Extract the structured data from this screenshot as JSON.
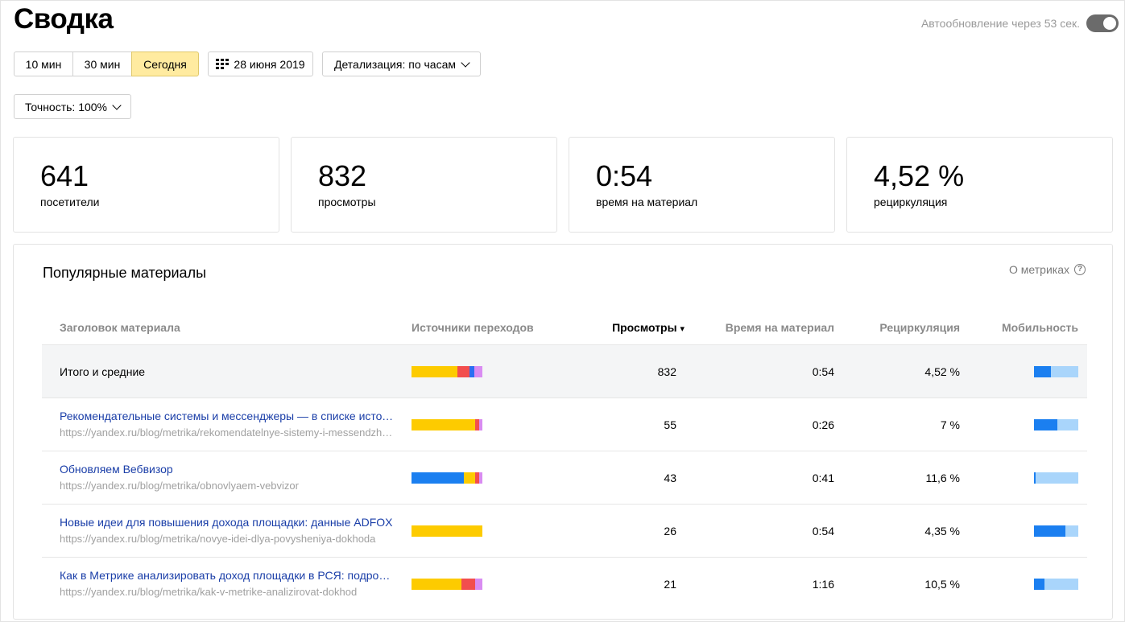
{
  "header": {
    "title": "Сводка",
    "autoupdate_text": "Автообновление через 53 сек."
  },
  "period": {
    "options": [
      "10 мин",
      "30 мин",
      "Сегодня"
    ],
    "active": "Сегодня"
  },
  "date_button": {
    "label": "28 июня 2019",
    "icon": "calendar-icon"
  },
  "detail_select": {
    "label": "Детализация: по часам"
  },
  "accuracy_select": {
    "label": "Точность: 100%"
  },
  "cards": [
    {
      "value": "641",
      "label": "посетители"
    },
    {
      "value": "832",
      "label": "просмотры"
    },
    {
      "value": "0:54",
      "label": "время на материал"
    },
    {
      "value": "4,52 %",
      "label": "рециркуляция"
    }
  ],
  "popular": {
    "title": "Популярные материалы",
    "about_label": "О метриках",
    "columns": {
      "title": "Заголовок материала",
      "sources": "Источники переходов",
      "views": "Просмотры",
      "sort_indicator": "▾",
      "time": "Время на материал",
      "recirc": "Рециркуляция",
      "mobility": "Мобильность"
    },
    "total": {
      "label": "Итого и средние",
      "views": "832",
      "time": "0:54",
      "recirc": "4,52 %",
      "mobility_share": 0.38,
      "sources": [
        {
          "share": 0.65,
          "color": "#fdcb00"
        },
        {
          "share": 0.17,
          "color": "#f24e4e"
        },
        {
          "share": 0.07,
          "color": "#2b6ef2"
        },
        {
          "share": 0.11,
          "color": "#d98cf2"
        }
      ]
    },
    "rows": [
      {
        "title": "Рекомендательные системы и мессенджеры — в списке источников",
        "url": "https://yandex.ru/blog/metrika/rekomendatelnye-sistemy-i-messendzhery",
        "views": "55",
        "time": "0:26",
        "recirc": "7 %",
        "mobility_share": 0.52,
        "sources": [
          {
            "share": 0.9,
            "color": "#fdcb00"
          },
          {
            "share": 0.05,
            "color": "#f24e4e"
          },
          {
            "share": 0.05,
            "color": "#d98cf2"
          }
        ]
      },
      {
        "title": "Обновляем Вебвизор",
        "url": "https://yandex.ru/blog/metrika/obnovlyaem-vebvizor",
        "views": "43",
        "time": "0:41",
        "recirc": "11,6 %",
        "mobility_share": 0.04,
        "sources": [
          {
            "share": 0.74,
            "color": "#1b7ff0"
          },
          {
            "share": 0.16,
            "color": "#fdcb00"
          },
          {
            "share": 0.06,
            "color": "#f24e4e"
          },
          {
            "share": 0.04,
            "color": "#d98cf2"
          }
        ]
      },
      {
        "title": "Новые идеи для повышения дохода площадки: данные ADFOX",
        "url": "https://yandex.ru/blog/metrika/novye-idei-dlya-povysheniya-dokhoda",
        "views": "26",
        "time": "0:54",
        "recirc": "4,35 %",
        "mobility_share": 0.7,
        "sources": [
          {
            "share": 1.0,
            "color": "#fdcb00"
          }
        ]
      },
      {
        "title": "Как в Метрике анализировать доход площадки в РСЯ: подробная инструкция",
        "url": "https://yandex.ru/blog/metrika/kak-v-metrike-analizirovat-dokhod",
        "views": "21",
        "time": "1:16",
        "recirc": "10,5 %",
        "mobility_share": 0.24,
        "sources": [
          {
            "share": 0.7,
            "color": "#fdcb00"
          },
          {
            "share": 0.2,
            "color": "#f24e4e"
          },
          {
            "share": 0.1,
            "color": "#d98cf2"
          }
        ]
      }
    ]
  }
}
